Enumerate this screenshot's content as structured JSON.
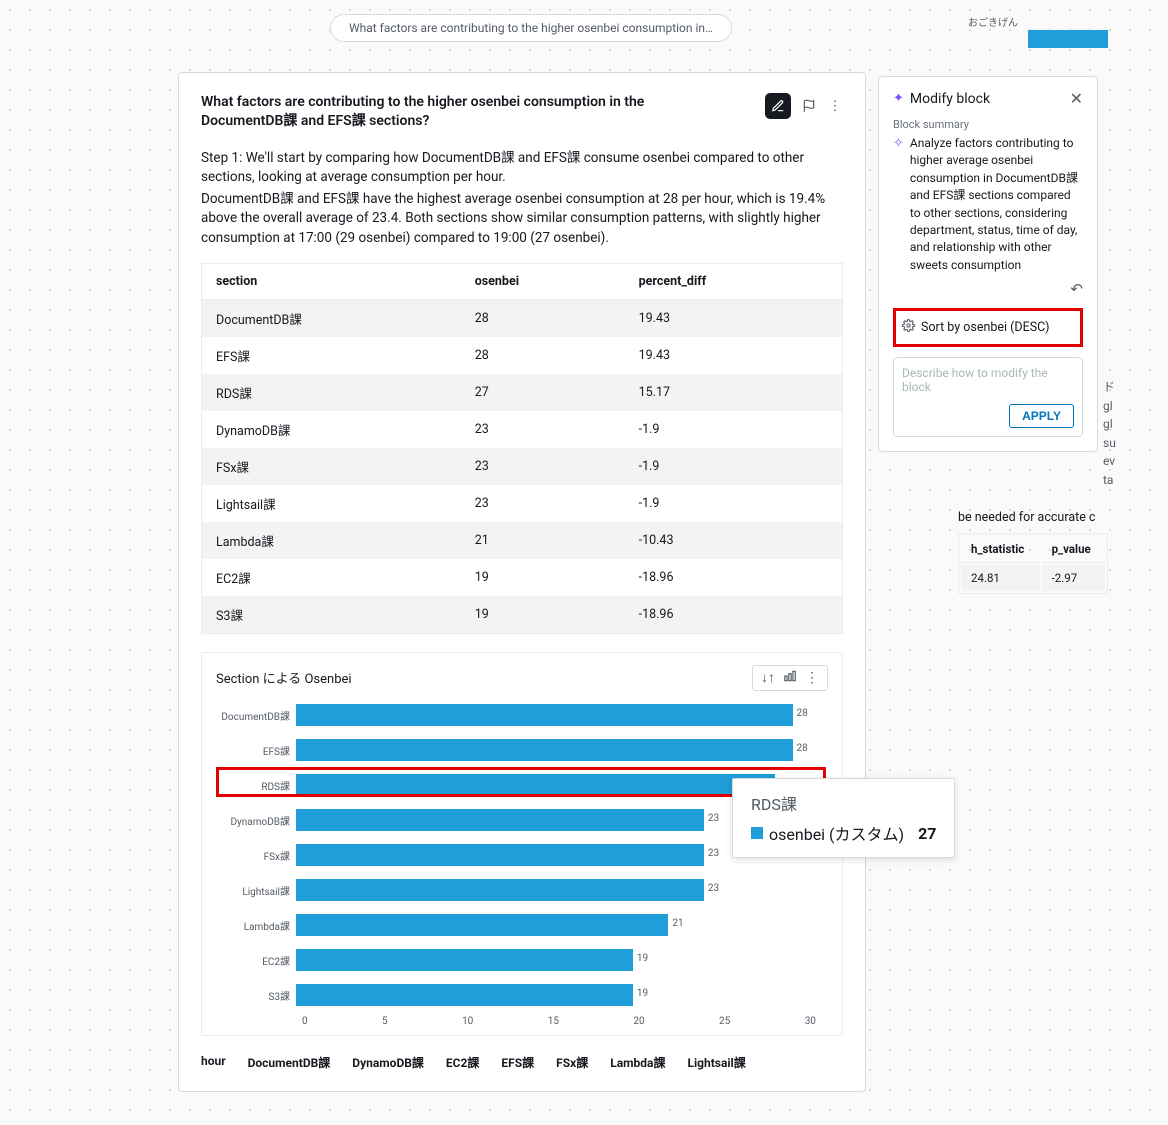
{
  "pill_text": "What factors are contributing to the higher osenbei consumption in…",
  "card": {
    "title": "What factors are contributing to the higher osenbei consumption in the DocumentDB課 and EFS課 sections?",
    "step1": "Step 1: We'll start by comparing how DocumentDB課 and EFS課 consume osenbei compared to other sections, looking at average consumption per hour.",
    "step1b": "DocumentDB課 and EFS課 have the highest average osenbei consumption at 28 per hour, which is 19.4% above the overall average of 23.4. Both sections show similar consumption patterns, with slightly higher consumption at 17:00 (29 osenbei) compared to 19:00 (27 osenbei)."
  },
  "table": {
    "headers": [
      "section",
      "osenbei",
      "percent_diff"
    ],
    "rows": [
      [
        "DocumentDB課",
        "28",
        "19.43"
      ],
      [
        "EFS課",
        "28",
        "19.43"
      ],
      [
        "RDS課",
        "27",
        "15.17"
      ],
      [
        "DynamoDB課",
        "23",
        "-1.9"
      ],
      [
        "FSx課",
        "23",
        "-1.9"
      ],
      [
        "Lightsail課",
        "23",
        "-1.9"
      ],
      [
        "Lambda課",
        "21",
        "-10.43"
      ],
      [
        "EC2課",
        "19",
        "-18.96"
      ],
      [
        "S3課",
        "19",
        "-18.96"
      ]
    ]
  },
  "chart": {
    "title": "Section による Osenbei"
  },
  "chart_data": {
    "type": "bar",
    "orientation": "horizontal",
    "title": "Section による Osenbei",
    "xlabel": "",
    "ylabel": "",
    "xlim": [
      0,
      30
    ],
    "x_ticks": [
      0,
      5,
      10,
      15,
      20,
      25,
      30
    ],
    "categories": [
      "DocumentDB課",
      "EFS課",
      "RDS課",
      "DynamoDB課",
      "FSx課",
      "Lightsail課",
      "Lambda課",
      "EC2課",
      "S3課"
    ],
    "values": [
      28,
      28,
      27,
      23,
      23,
      23,
      21,
      19,
      19
    ],
    "highlighted_index": 2
  },
  "lower_headers": [
    "hour",
    "DocumentDB課",
    "DynamoDB課",
    "EC2課",
    "EFS課",
    "FSx課",
    "Lambda課",
    "Lightsail課"
  ],
  "side": {
    "title": "Modify block",
    "summary_label": "Block summary",
    "summary_text": "Analyze factors contributing to higher average osenbei consumption in DocumentDB課 and EFS課 sections compared to other sections, considering department, status, time of day, and relationship with other sweets consumption",
    "sort_label": "Sort by osenbei (DESC)",
    "placeholder": "Describe how to modify the block",
    "apply": "APPLY"
  },
  "tiny_label": "おごきげん",
  "lower_side_text": "be needed for accurate c",
  "mini_table": {
    "headers": [
      "h_statistic",
      "p_value"
    ],
    "row": [
      "24.81",
      "-2.97"
    ]
  },
  "side_letters": [
    "ド",
    "gl",
    "gl",
    "su",
    "ev",
    "ta"
  ],
  "tooltip": {
    "title": "RDS課",
    "series": "osenbei (カスタム)",
    "value": "27"
  }
}
